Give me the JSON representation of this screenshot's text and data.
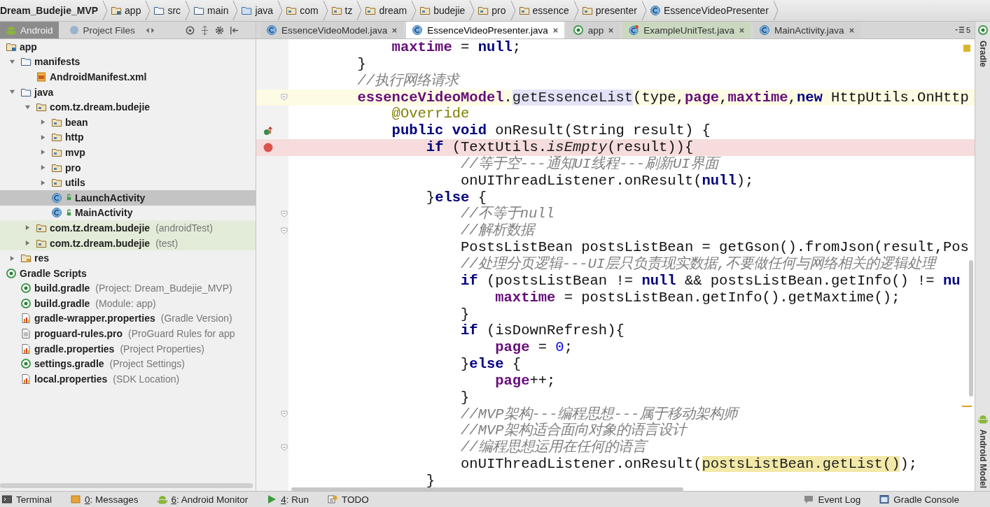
{
  "breadcrumbs": [
    {
      "label": "Dream_Budejie_MVP"
    },
    {
      "label": "app"
    },
    {
      "label": "src"
    },
    {
      "label": "main"
    },
    {
      "label": "java"
    },
    {
      "label": "com"
    },
    {
      "label": "tz"
    },
    {
      "label": "dream"
    },
    {
      "label": "budejie"
    },
    {
      "label": "pro"
    },
    {
      "label": "essence"
    },
    {
      "label": "presenter"
    },
    {
      "label": "EssenceVideoPresenter"
    }
  ],
  "project_panel": {
    "views": [
      {
        "label": "Android",
        "selected": true
      },
      {
        "label": "Project Files",
        "selected": false
      }
    ],
    "tree": [
      {
        "label": "app",
        "kind": "module",
        "selected": false,
        "children": [
          {
            "label": "manifests",
            "kind": "folder",
            "expanded": true,
            "selected": false,
            "children": [
              {
                "label": "AndroidManifest.xml",
                "kind": "manifest",
                "selected": false
              }
            ]
          },
          {
            "label": "java",
            "kind": "folder",
            "expanded": true,
            "selected": false,
            "children": [
              {
                "label": "com.tz.dream.budejie",
                "kind": "package",
                "expanded": true,
                "selected": false,
                "children": [
                  {
                    "label": "bean",
                    "kind": "package",
                    "expanded": false,
                    "selected": false
                  },
                  {
                    "label": "http",
                    "kind": "package",
                    "expanded": false,
                    "selected": false
                  },
                  {
                    "label": "mvp",
                    "kind": "package",
                    "expanded": false,
                    "selected": false
                  },
                  {
                    "label": "pro",
                    "kind": "package",
                    "expanded": false,
                    "selected": false
                  },
                  {
                    "label": "utils",
                    "kind": "package",
                    "expanded": false,
                    "selected": false
                  },
                  {
                    "label": "LaunchActivity",
                    "kind": "class",
                    "selected": true
                  },
                  {
                    "label": "MainActivity",
                    "kind": "class",
                    "selected": false
                  }
                ]
              },
              {
                "label": "com.tz.dream.budejie",
                "note": "(androidTest)",
                "kind": "package",
                "expanded": false,
                "selected": false,
                "tinted": true
              },
              {
                "label": "com.tz.dream.budejie",
                "note": "(test)",
                "kind": "package",
                "expanded": false,
                "selected": false,
                "tinted": true
              }
            ]
          },
          {
            "label": "res",
            "kind": "resfolder",
            "expanded": false,
            "selected": false
          }
        ]
      },
      {
        "label": "Gradle Scripts",
        "kind": "gradle",
        "selected": false,
        "children": [
          {
            "label": "build.gradle",
            "note": "(Project: Dream_Budejie_MVP)",
            "kind": "gradle",
            "selected": false
          },
          {
            "label": "build.gradle",
            "note": "(Module: app)",
            "kind": "gradle",
            "selected": false
          },
          {
            "label": "gradle-wrapper.properties",
            "note": "(Gradle Version)",
            "kind": "props",
            "selected": false
          },
          {
            "label": "proguard-rules.pro",
            "note": "(ProGuard Rules for app",
            "kind": "file",
            "selected": false
          },
          {
            "label": "gradle.properties",
            "note": "(Project Properties)",
            "kind": "props",
            "selected": false
          },
          {
            "label": "settings.gradle",
            "note": "(Project Settings)",
            "kind": "gradle",
            "selected": false
          },
          {
            "label": "local.properties",
            "note": "(SDK Location)",
            "kind": "props",
            "selected": false
          }
        ]
      }
    ]
  },
  "editor_tabs": [
    {
      "label": "EssenceVideoModel.java",
      "kind": "class",
      "selected": false
    },
    {
      "label": "EssenceVideoPresenter.java",
      "kind": "class",
      "selected": true
    },
    {
      "label": "app",
      "kind": "gradle",
      "selected": false
    },
    {
      "label": "ExampleUnitTest.java",
      "kind": "test",
      "selected": false,
      "tinted": true
    },
    {
      "label": "MainActivity.java",
      "kind": "class",
      "selected": false
    }
  ],
  "hidden_tabs_count": "5",
  "code": [
    {
      "children": [
        {
          "tokens": [
            {
              "kind": "field",
              "text": "maxtime"
            },
            {
              "kind": "plain",
              "text": " = "
            },
            {
              "kind": "keyword",
              "text": "null"
            },
            {
              "kind": "plain",
              "text": ";"
            }
          ]
        }
      ]
    },
    {
      "tokens": [
        {
          "kind": "plain",
          "text": "}"
        }
      ]
    },
    {
      "tokens": [
        {
          "kind": "comment",
          "text": "//执行网络请求"
        }
      ]
    },
    {
      "current": true,
      "kind": "fold",
      "tokens": [
        {
          "kind": "field",
          "text": "essenceVideoModel"
        },
        {
          "kind": "plain",
          "text": "."
        },
        {
          "kind": "highlight",
          "text": "getEssenceList"
        },
        {
          "kind": "plain",
          "text": "(type,"
        },
        {
          "kind": "field",
          "text": "page"
        },
        {
          "kind": "plain",
          "text": ","
        },
        {
          "kind": "field",
          "text": "maxtime"
        },
        {
          "kind": "plain",
          "text": ","
        },
        {
          "kind": "keyword",
          "text": "new"
        },
        {
          "kind": "plain",
          "text": " HttpUtils.OnHttp"
        }
      ],
      "children": [
        {
          "tokens": [
            {
              "kind": "annotation",
              "text": "@Override"
            }
          ]
        },
        {
          "kind": "override",
          "tokens": [
            {
              "kind": "keyword",
              "text": "public void"
            },
            {
              "kind": "plain",
              "text": " onResult(String result) {"
            }
          ],
          "children": [
            {
              "kind": "breakpoint",
              "tokens": [
                {
                  "kind": "keyword",
                  "text": "if"
                },
                {
                  "kind": "plain",
                  "text": " (TextUtils."
                },
                {
                  "kind": "italic",
                  "text": "isEmpty"
                },
                {
                  "kind": "plain",
                  "text": "(result)){"
                }
              ],
              "children": [
                {
                  "tokens": [
                    {
                      "kind": "comment",
                      "text": "//等于空---通知UI线程---刷新UI界面"
                    }
                  ]
                },
                {
                  "tokens": [
                    {
                      "kind": "plain",
                      "text": "onUIThreadListener.onResult("
                    },
                    {
                      "kind": "keyword",
                      "text": "null"
                    },
                    {
                      "kind": "plain",
                      "text": ");"
                    }
                  ]
                }
              ]
            },
            {
              "tokens": [
                {
                  "kind": "plain",
                  "text": "}"
                },
                {
                  "kind": "keyword",
                  "text": "else"
                },
                {
                  "kind": "plain",
                  "text": " {"
                }
              ],
              "children": [
                {
                  "kind": "fold",
                  "tokens": [
                    {
                      "kind": "comment",
                      "text": "//不等于null"
                    }
                  ]
                },
                {
                  "kind": "fold",
                  "tokens": [
                    {
                      "kind": "comment",
                      "text": "//解析数据"
                    }
                  ]
                },
                {
                  "tokens": [
                    {
                      "kind": "plain",
                      "text": "PostsListBean postsListBean = getGson().fromJson(result,Pos"
                    }
                  ]
                },
                {
                  "tokens": [
                    {
                      "kind": "comment",
                      "text": "//处理分页逻辑---UI层只负责现实数据,不要做任何与网络相关的逻辑处理"
                    }
                  ]
                },
                {
                  "tokens": [
                    {
                      "kind": "keyword",
                      "text": "if"
                    },
                    {
                      "kind": "plain",
                      "text": " (postsListBean != "
                    },
                    {
                      "kind": "keyword",
                      "text": "null"
                    },
                    {
                      "kind": "plain",
                      "text": " && postsListBean.getInfo() != "
                    },
                    {
                      "kind": "keyword",
                      "text": "nu"
                    }
                  ],
                  "children": [
                    {
                      "tokens": [
                        {
                          "kind": "field",
                          "text": "maxtime"
                        },
                        {
                          "kind": "plain",
                          "text": " = postsListBean.getInfo().getMaxtime();"
                        }
                      ]
                    }
                  ]
                },
                {
                  "tokens": [
                    {
                      "kind": "plain",
                      "text": "}"
                    }
                  ]
                },
                {
                  "tokens": [
                    {
                      "kind": "keyword",
                      "text": "if"
                    },
                    {
                      "kind": "plain",
                      "text": " (isDownRefresh){"
                    }
                  ],
                  "children": [
                    {
                      "tokens": [
                        {
                          "kind": "field",
                          "text": "page"
                        },
                        {
                          "kind": "plain",
                          "text": " = "
                        },
                        {
                          "kind": "number",
                          "text": "0"
                        },
                        {
                          "kind": "plain",
                          "text": ";"
                        }
                      ]
                    }
                  ]
                },
                {
                  "tokens": [
                    {
                      "kind": "plain",
                      "text": "}"
                    },
                    {
                      "kind": "keyword",
                      "text": "else"
                    },
                    {
                      "kind": "plain",
                      "text": " {"
                    }
                  ],
                  "children": [
                    {
                      "tokens": [
                        {
                          "kind": "field",
                          "text": "page"
                        },
                        {
                          "kind": "plain",
                          "text": "++;"
                        }
                      ]
                    }
                  ]
                },
                {
                  "tokens": [
                    {
                      "kind": "plain",
                      "text": "}"
                    }
                  ]
                },
                {
                  "kind": "fold",
                  "tokens": [
                    {
                      "kind": "comment",
                      "text": "//MVP架构---编程思想---属于移动架构师"
                    }
                  ]
                },
                {
                  "tokens": [
                    {
                      "kind": "comment",
                      "text": "//MVP架构适合面向对象的语言设计"
                    }
                  ]
                },
                {
                  "kind": "fold",
                  "tokens": [
                    {
                      "kind": "comment",
                      "text": "//编程思想运用在任何的语言"
                    }
                  ]
                },
                {
                  "tokens": [
                    {
                      "kind": "plain",
                      "text": "onUIThreadListener.onResult("
                    },
                    {
                      "kind": "match",
                      "text": "postsListBean.getList()"
                    },
                    {
                      "kind": "plain",
                      "text": ");"
                    }
                  ]
                }
              ]
            },
            {
              "tokens": [
                {
                  "kind": "plain",
                  "text": "}"
                }
              ]
            }
          ]
        }
      ]
    }
  ],
  "right_stripe": [
    {
      "label": "Gradle"
    },
    {
      "label": "Android Model"
    }
  ],
  "bottom_left": [
    {
      "label": "Terminal"
    },
    {
      "mnemonic": "0",
      "label": ": Messages"
    },
    {
      "mnemonic": "6",
      "label": ": Android Monitor"
    },
    {
      "mnemonic": "4",
      "label": ": Run"
    },
    {
      "label": "TODO"
    }
  ],
  "bottom_right": [
    {
      "label": "Event Log"
    },
    {
      "label": "Gradle Console"
    }
  ]
}
